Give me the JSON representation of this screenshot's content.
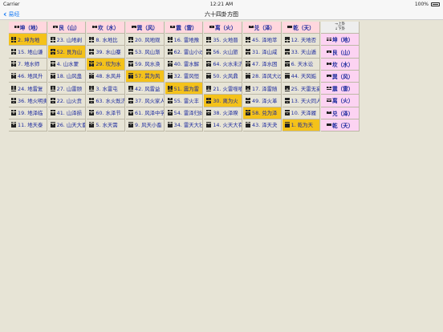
{
  "status_bar": {
    "carrier": "Carrier",
    "time": "12:21 AM",
    "battery": "100%"
  },
  "nav": {
    "back_label": "易经",
    "title": "六十四卦方图"
  },
  "corner": {
    "upper": "→上卦",
    "lower": "↓下卦"
  },
  "trigrams": [
    {
      "label": "坤（地）",
      "lines": [
        0,
        0,
        0
      ]
    },
    {
      "label": "艮（山）",
      "lines": [
        1,
        0,
        0
      ]
    },
    {
      "label": "坎（水）",
      "lines": [
        0,
        1,
        0
      ]
    },
    {
      "label": "巽（风）",
      "lines": [
        1,
        1,
        0
      ]
    },
    {
      "label": "震（雷）",
      "lines": [
        0,
        0,
        1
      ]
    },
    {
      "label": "离（火）",
      "lines": [
        1,
        0,
        1
      ]
    },
    {
      "label": "兑（泽）",
      "lines": [
        0,
        1,
        1
      ]
    },
    {
      "label": "乾（天）",
      "lines": [
        1,
        1,
        1
      ]
    }
  ],
  "rows": [
    [
      "2. 坤为地",
      "23. 山地剥",
      "8. 水地比",
      "20. 风地观",
      "16. 雷地豫",
      "35. 火地晋",
      "45. 泽地萃",
      "12. 天地否"
    ],
    [
      "15. 地山谦",
      "52. 艮为山",
      "39. 水山蹇",
      "53. 风山渐",
      "62. 雷山小过",
      "56. 火山旅",
      "31. 泽山咸",
      "33. 天山遁"
    ],
    [
      "7. 地水师",
      "4. 山水蒙",
      "29. 坎为水",
      "59. 风水涣",
      "40. 雷水解",
      "64. 火水未济",
      "47. 泽水困",
      "6. 天水讼"
    ],
    [
      "46. 地风升",
      "18. 山风蛊",
      "48. 水风井",
      "57. 巽为风",
      "32. 雷风恒",
      "50. 火风鼎",
      "28. 泽风大过",
      "44. 天风姤"
    ],
    [
      "24. 地雷复",
      "27. 山雷颐",
      "3. 水雷屯",
      "42. 风雷益",
      "51. 震为雷",
      "21. 火雷噬嗑",
      "17. 泽雷随",
      "25. 天雷无妄"
    ],
    [
      "36. 地火明夷",
      "22. 山火贲",
      "63. 水火既济",
      "37. 风火家人",
      "55. 雷火丰",
      "30. 离为火",
      "49. 泽火革",
      "13. 天火同人"
    ],
    [
      "19. 地泽临",
      "41. 山泽损",
      "60. 水泽节",
      "61. 风泽中孚",
      "54. 雷泽归妹",
      "38. 火泽睽",
      "58. 兑为泽",
      "10. 天泽履"
    ],
    [
      "11. 地天泰",
      "26. 山天大畜",
      "5. 水天需",
      "9. 风天小畜",
      "34. 雷天大壮",
      "14. 火天大有",
      "43. 泽天夬",
      "1. 乾为天"
    ]
  ],
  "colors": {
    "highlight": "#f4c21a",
    "header_bg": "#ffd7de",
    "text": "#1c2a9e",
    "background": "#e7e4d6"
  }
}
